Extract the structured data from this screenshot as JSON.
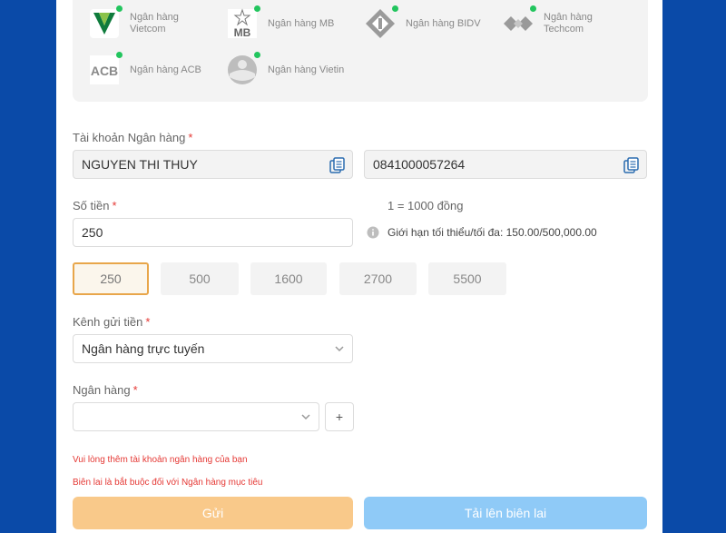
{
  "banks": [
    {
      "name": "Ngân hàng\nVietcom",
      "icon": "vietcombank-logo-icon"
    },
    {
      "name": "Ngân hàng MB",
      "icon": "mb-logo-icon",
      "logo_text": "MB"
    },
    {
      "name": "Ngân hàng BIDV",
      "icon": "bidv-logo-icon"
    },
    {
      "name": "Ngân hàng\nTechcom",
      "icon": "techcombank-logo-icon"
    },
    {
      "name": "Ngân hàng ACB",
      "icon": "acb-logo-icon",
      "logo_text": "ACB"
    },
    {
      "name": "Ngân hàng Vietin",
      "icon": "vietinbank-logo-icon"
    }
  ],
  "account": {
    "label": "Tài khoản Ngân hàng",
    "required_mark": "*",
    "name_value": "NGUYEN THI THUY",
    "number_value": "0841000057264"
  },
  "amount": {
    "label": "Số tiền",
    "required_mark": "*",
    "value": "250",
    "rate": "1 = 1000 đồng",
    "limit": "Giới hạn tối thiểu/tối đa: 150.00/500,000.00",
    "presets": [
      "250",
      "500",
      "1600",
      "2700",
      "5500"
    ],
    "selected_index": 0
  },
  "channel": {
    "label": "Kênh gửi tiền",
    "required_mark": "*",
    "value": "Ngân hàng trực tuyến"
  },
  "bank_select": {
    "label": "Ngân hàng",
    "required_mark": "*",
    "value": "",
    "add_label": "+"
  },
  "errors": {
    "add_account": "Vui lòng thêm tài khoản ngân hàng của bạn",
    "receipt_required": "Biên lai là bắt buộc đối với Ngân hàng mục tiêu"
  },
  "buttons": {
    "submit": "Gửi",
    "upload": "Tải lên biên lai"
  },
  "colors": {
    "background": "#0a4aa8",
    "submit_button": "#f9c98a",
    "upload_button": "#8fcaf7",
    "active_chip_border": "#e8a64a",
    "error": "#e53935",
    "online_dot": "#22c55e"
  }
}
